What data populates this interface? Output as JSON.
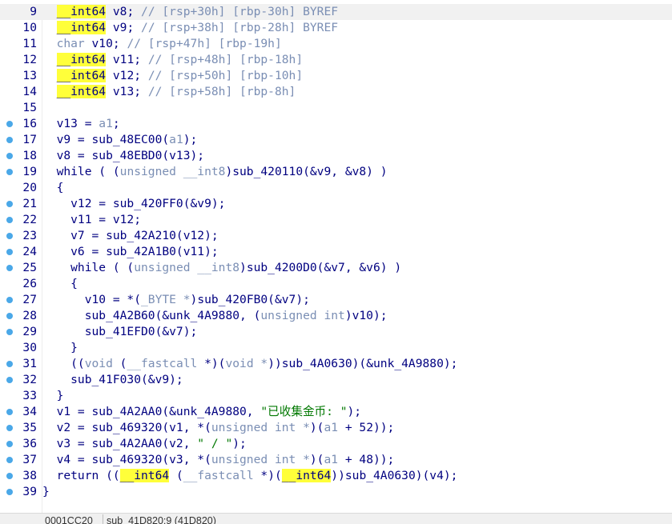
{
  "colors": {
    "keyword_highlight": "#ffff3a",
    "breakpoint_dot": "#4aa8e8",
    "code_text": "#000080",
    "comment_text": "#7a8eb4",
    "string_text": "#007800"
  },
  "status_bar": {
    "address": "0001CC20",
    "function": "sub_41D820:9 (41D820)"
  },
  "lines": [
    {
      "num": "9",
      "dot": false,
      "current": true,
      "segs": [
        {
          "t": "  "
        },
        {
          "t": "__int64",
          "k": "hl"
        },
        {
          "t": " v8; "
        },
        {
          "t": "// [rsp+30h] [rbp-30h] BYREF",
          "k": "c"
        }
      ]
    },
    {
      "num": "10",
      "dot": false,
      "segs": [
        {
          "t": "  "
        },
        {
          "t": "__int64",
          "k": "hl"
        },
        {
          "t": " v9; "
        },
        {
          "t": "// [rsp+38h] [rbp-28h] BYREF",
          "k": "c"
        }
      ]
    },
    {
      "num": "11",
      "dot": false,
      "segs": [
        {
          "t": "  "
        },
        {
          "t": "char",
          "k": "g"
        },
        {
          "t": " v10; "
        },
        {
          "t": "// [rsp+47h] [rbp-19h]",
          "k": "c"
        }
      ]
    },
    {
      "num": "12",
      "dot": false,
      "segs": [
        {
          "t": "  "
        },
        {
          "t": "__int64",
          "k": "hl"
        },
        {
          "t": " v11; "
        },
        {
          "t": "// [rsp+48h] [rbp-18h]",
          "k": "c"
        }
      ]
    },
    {
      "num": "13",
      "dot": false,
      "segs": [
        {
          "t": "  "
        },
        {
          "t": "__int64",
          "k": "hl"
        },
        {
          "t": " v12; "
        },
        {
          "t": "// [rsp+50h] [rbp-10h]",
          "k": "c"
        }
      ]
    },
    {
      "num": "14",
      "dot": false,
      "segs": [
        {
          "t": "  "
        },
        {
          "t": "__int64",
          "k": "hl"
        },
        {
          "t": " v13; "
        },
        {
          "t": "// [rsp+58h] [rbp-8h]",
          "k": "c"
        }
      ]
    },
    {
      "num": "15",
      "dot": false,
      "segs": []
    },
    {
      "num": "16",
      "dot": true,
      "segs": [
        {
          "t": "  v13 = "
        },
        {
          "t": "a1",
          "k": "g"
        },
        {
          "t": ";"
        }
      ]
    },
    {
      "num": "17",
      "dot": true,
      "segs": [
        {
          "t": "  v9 = sub_48EC00("
        },
        {
          "t": "a1",
          "k": "g"
        },
        {
          "t": ");"
        }
      ]
    },
    {
      "num": "18",
      "dot": true,
      "segs": [
        {
          "t": "  v8 = sub_48EBD0(v13);"
        }
      ]
    },
    {
      "num": "19",
      "dot": true,
      "segs": [
        {
          "t": "  while ( ("
        },
        {
          "t": "unsigned __int8",
          "k": "g"
        },
        {
          "t": ")sub_420110(&v9, &v8) )"
        }
      ]
    },
    {
      "num": "20",
      "dot": false,
      "segs": [
        {
          "t": "  {"
        }
      ]
    },
    {
      "num": "21",
      "dot": true,
      "segs": [
        {
          "t": "    v12 = sub_420FF0(&v9);"
        }
      ]
    },
    {
      "num": "22",
      "dot": true,
      "segs": [
        {
          "t": "    v11 = v12;"
        }
      ]
    },
    {
      "num": "23",
      "dot": true,
      "segs": [
        {
          "t": "    v7 = sub_42A210(v12);"
        }
      ]
    },
    {
      "num": "24",
      "dot": true,
      "segs": [
        {
          "t": "    v6 = sub_42A1B0(v11);"
        }
      ]
    },
    {
      "num": "25",
      "dot": true,
      "segs": [
        {
          "t": "    while ( ("
        },
        {
          "t": "unsigned __int8",
          "k": "g"
        },
        {
          "t": ")sub_4200D0(&v7, &v6) )"
        }
      ]
    },
    {
      "num": "26",
      "dot": false,
      "segs": [
        {
          "t": "    {"
        }
      ]
    },
    {
      "num": "27",
      "dot": true,
      "segs": [
        {
          "t": "      v10 = *("
        },
        {
          "t": "_BYTE *",
          "k": "g"
        },
        {
          "t": ")sub_420FB0(&v7);"
        }
      ]
    },
    {
      "num": "28",
      "dot": true,
      "segs": [
        {
          "t": "      sub_4A2B60(&unk_4A9880, ("
        },
        {
          "t": "unsigned int",
          "k": "g"
        },
        {
          "t": ")v10);"
        }
      ]
    },
    {
      "num": "29",
      "dot": true,
      "segs": [
        {
          "t": "      sub_41EFD0(&v7);"
        }
      ]
    },
    {
      "num": "30",
      "dot": false,
      "segs": [
        {
          "t": "    }"
        }
      ]
    },
    {
      "num": "31",
      "dot": true,
      "segs": [
        {
          "t": "    (("
        },
        {
          "t": "void",
          "k": "g"
        },
        {
          "t": " ("
        },
        {
          "t": "__fastcall",
          "k": "g"
        },
        {
          "t": " *)("
        },
        {
          "t": "void *",
          "k": "g"
        },
        {
          "t": "))sub_4A0630)(&unk_4A9880);"
        }
      ]
    },
    {
      "num": "32",
      "dot": true,
      "segs": [
        {
          "t": "    sub_41F030(&v9);"
        }
      ]
    },
    {
      "num": "33",
      "dot": false,
      "segs": [
        {
          "t": "  }"
        }
      ]
    },
    {
      "num": "34",
      "dot": true,
      "segs": [
        {
          "t": "  v1 = sub_4A2AA0(&unk_4A9880, "
        },
        {
          "t": "\"已收集金币: \"",
          "k": "s"
        },
        {
          "t": ");"
        }
      ]
    },
    {
      "num": "35",
      "dot": true,
      "segs": [
        {
          "t": "  v2 = sub_469320(v1, *("
        },
        {
          "t": "unsigned int *",
          "k": "g"
        },
        {
          "t": ")("
        },
        {
          "t": "a1",
          "k": "g"
        },
        {
          "t": " + 52));"
        }
      ]
    },
    {
      "num": "36",
      "dot": true,
      "segs": [
        {
          "t": "  v3 = sub_4A2AA0(v2, "
        },
        {
          "t": "\" / \"",
          "k": "s"
        },
        {
          "t": ");"
        }
      ]
    },
    {
      "num": "37",
      "dot": true,
      "segs": [
        {
          "t": "  v4 = sub_469320(v3, *("
        },
        {
          "t": "unsigned int *",
          "k": "g"
        },
        {
          "t": ")("
        },
        {
          "t": "a1",
          "k": "g"
        },
        {
          "t": " + 48));"
        }
      ]
    },
    {
      "num": "38",
      "dot": true,
      "segs": [
        {
          "t": "  return (("
        },
        {
          "t": "__int64",
          "k": "hl"
        },
        {
          "t": " ("
        },
        {
          "t": "__fastcall",
          "k": "g"
        },
        {
          "t": " *)("
        },
        {
          "t": "__int64",
          "k": "hl"
        },
        {
          "t": "))sub_4A0630)(v4);"
        }
      ]
    },
    {
      "num": "39",
      "dot": true,
      "segs": [
        {
          "t": "}"
        }
      ]
    }
  ]
}
